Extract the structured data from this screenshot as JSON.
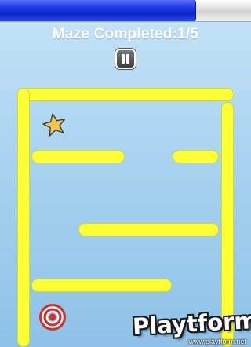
{
  "progress": {
    "level": 0.78,
    "fill_color": "#1f3ae8",
    "track_color": "#dcdcdc"
  },
  "status": {
    "text": "Maze Completed:1/5"
  },
  "pause_button": {
    "icon": "pause-icon"
  },
  "maze": {
    "wall_color": "#ffff33",
    "wall_border_color": "#c8d84a",
    "player_icon": "star-icon",
    "player_color": "#f2c64e",
    "goal_icon": "target-icon",
    "goal_color": "#d0342c"
  },
  "watermark": {
    "logo": "Playtform",
    "url": "www.playtform.net"
  }
}
